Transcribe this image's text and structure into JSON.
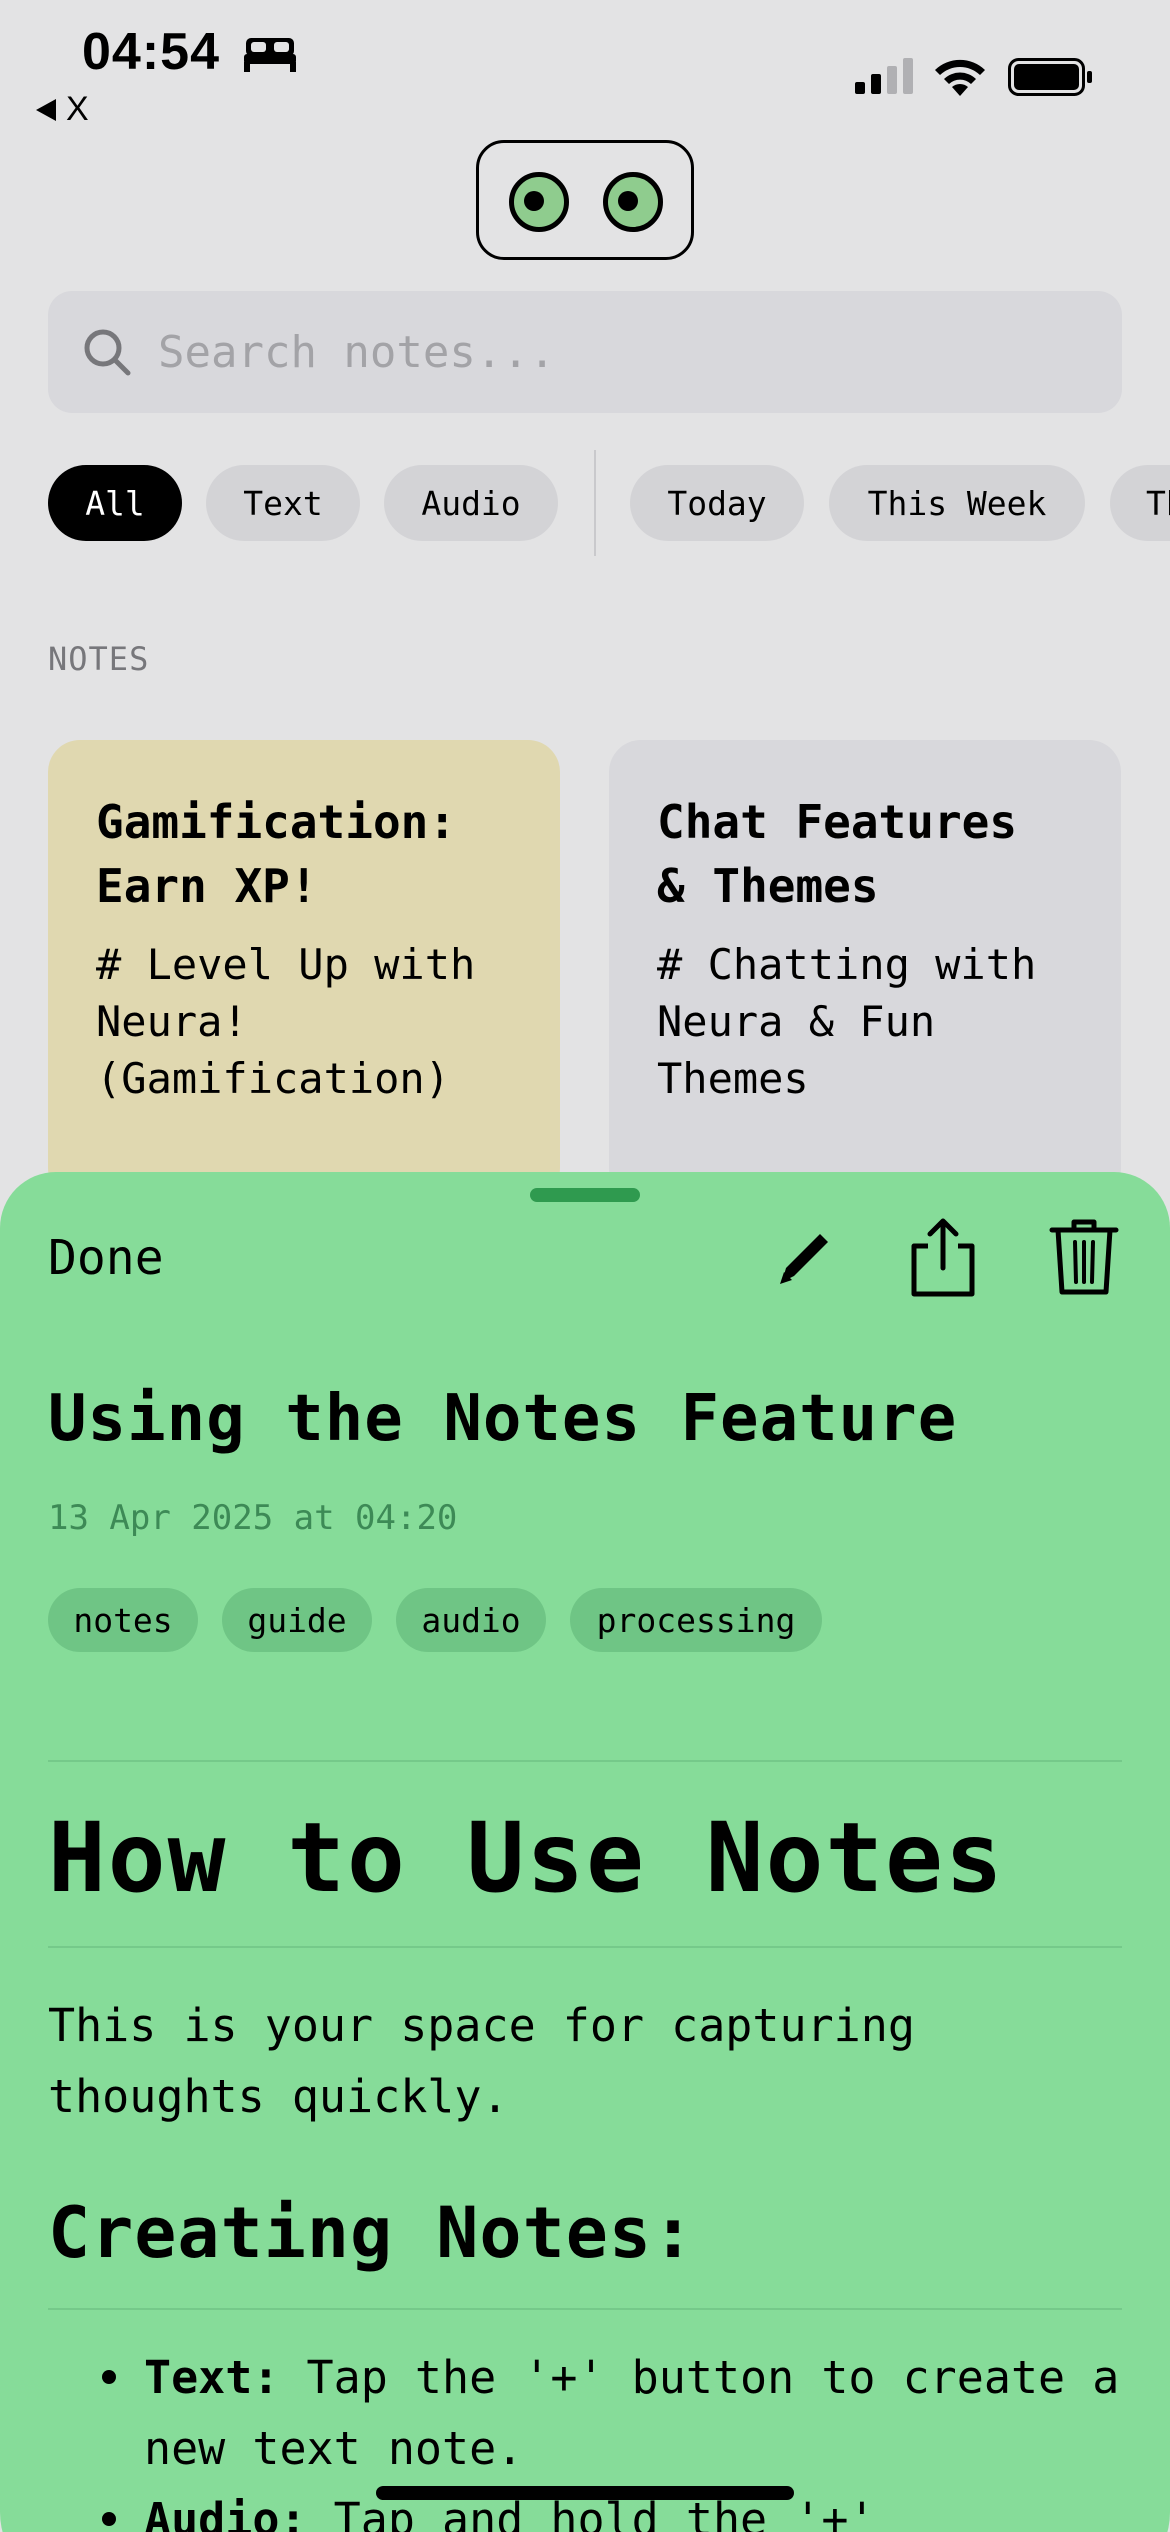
{
  "status_bar": {
    "time": "04:54",
    "back_label": "X"
  },
  "search": {
    "placeholder": "Search notes..."
  },
  "filters": {
    "type_chips": [
      "All",
      "Text",
      "Audio"
    ],
    "date_chips": [
      "Today",
      "This Week",
      "Th"
    ],
    "active": "All"
  },
  "notes_section": {
    "label": "NOTES",
    "cards": [
      {
        "title": "Gamification:\nEarn XP!",
        "preview": "# Level Up with\nNeura!\n(Gamification)",
        "color": "#e0d8b0"
      },
      {
        "title": "Chat Features\n& Themes",
        "preview": "# Chatting with\nNeura & Fun\nThemes",
        "color": "#d8d8dc"
      }
    ]
  },
  "sheet": {
    "done_label": "Done",
    "title": "Using the Notes Feature",
    "date": "13 Apr 2025 at 04:20",
    "tags": [
      "notes",
      "guide",
      "audio",
      "processing"
    ],
    "heading": "How to Use Notes",
    "paragraph": "This is your space for capturing thoughts quickly.",
    "subheading": "Creating Notes:",
    "bullets": [
      {
        "bold": "Text:",
        "text": " Tap the '+' button to create a new text note."
      },
      {
        "bold": "Audio:",
        "text": " Tap and hold the '+'"
      }
    ],
    "color": "#86dc99"
  },
  "icons": {
    "bed": "bed-icon",
    "signal": "cellular-signal-icon",
    "wifi": "wifi-icon",
    "battery": "battery-icon",
    "search": "search-icon",
    "edit": "pencil-icon",
    "share": "share-icon",
    "trash": "trash-icon"
  }
}
